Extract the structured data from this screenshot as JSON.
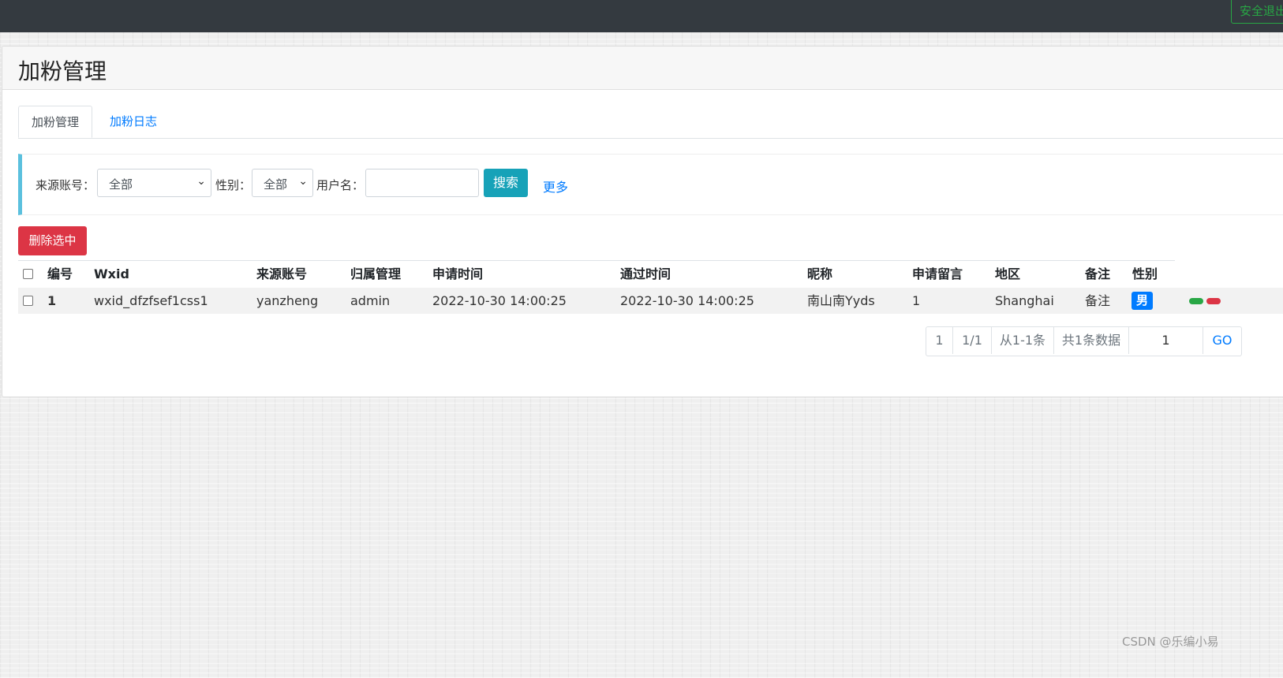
{
  "topbar": {
    "logout_label": "安全退出"
  },
  "header": {
    "title": "加粉管理"
  },
  "tabs": [
    {
      "label": "加粉管理",
      "active": true
    },
    {
      "label": "加粉日志",
      "active": false
    }
  ],
  "filters": {
    "source_label": "来源账号：",
    "source_value": "全部",
    "gender_label": "性别：",
    "gender_value": "全部",
    "username_label": "用户名：",
    "username_value": "",
    "search_label": "搜索",
    "more_label": "更多"
  },
  "actions": {
    "delete_selected_label": "删除选中"
  },
  "table": {
    "columns": [
      "编号",
      "Wxid",
      "来源账号",
      "归属管理",
      "申请时间",
      "通过时间",
      "昵称",
      "申请留言",
      "地区",
      "备注",
      "性别"
    ],
    "rows": [
      {
        "id": "1",
        "wxid": "wxid_dfzfsef1css1",
        "source": "yanzheng",
        "owner": "admin",
        "apply_time": "2022-10-30 14:00:25",
        "pass_time": "2022-10-30 14:00:25",
        "nickname": "南山南Yyds",
        "message": "1",
        "region": "Shanghai",
        "remark": "备注",
        "gender": "男"
      }
    ]
  },
  "pagination": {
    "current": "1",
    "pages": "1/1",
    "range": "从1-1条",
    "total": "共1条数据",
    "goto_value": "1",
    "go_label": "GO"
  },
  "watermark": "CSDN @乐编小易",
  "colors": {
    "accent": "#007bff",
    "danger": "#dc3545",
    "info": "#17a2b8",
    "success": "#28a745",
    "topbar": "#343a40"
  }
}
